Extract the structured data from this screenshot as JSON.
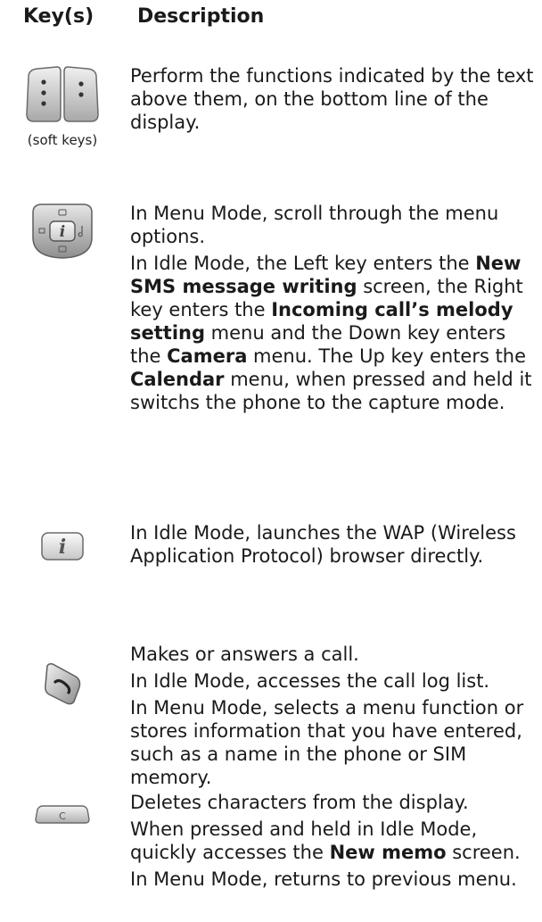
{
  "header": {
    "key_col": "Key(s)",
    "desc_col": "Description"
  },
  "rows": [
    {
      "caption": "(soft keys)",
      "icon": "soft-keys-icon",
      "paragraphs": [
        [
          {
            "t": "Perform the functions indicated by the text above them, on the bottom line of the display.",
            "b": false
          }
        ]
      ]
    },
    {
      "icon": "navigation-keys-icon",
      "paragraphs": [
        [
          {
            "t": "In Menu Mode, scroll through the menu options.",
            "b": false
          }
        ],
        [
          {
            "t": "In Idle Mode, the Left key enters the ",
            "b": false
          },
          {
            "t": "New SMS message writing",
            "b": true
          },
          {
            "t": " screen, the Right key enters the ",
            "b": false
          },
          {
            "t": "Incoming call’s melody setting",
            "b": true
          },
          {
            "t": " menu and the Down key enters the ",
            "b": false
          },
          {
            "t": "Camera",
            "b": true
          },
          {
            "t": " menu. The Up key enters the ",
            "b": false
          },
          {
            "t": "Calendar",
            "b": true
          },
          {
            "t": " menu, when pressed and held it switchs the phone to the capture mode.",
            "b": false
          }
        ]
      ]
    },
    {
      "icon": "wap-info-key-icon",
      "paragraphs": [
        [
          {
            "t": "In Idle Mode, launches the WAP (Wireless Application Protocol) browser directly.",
            "b": false
          }
        ]
      ]
    },
    {
      "icon": "send-call-key-icon",
      "paragraphs": [
        [
          {
            "t": "Makes or answers a call.",
            "b": false
          }
        ],
        [
          {
            "t": "In Idle Mode, accesses the call log list.",
            "b": false
          }
        ],
        [
          {
            "t": "In Menu Mode, selects a menu function or stores information that you have entered, such as a name in the phone or SIM memory.",
            "b": false
          }
        ]
      ]
    },
    {
      "icon": "clear-key-icon",
      "key_letter": "C",
      "paragraphs": [
        [
          {
            "t": "Deletes characters from the display.",
            "b": false
          }
        ],
        [
          {
            "t": "When pressed and held in Idle Mode, quickly accesses the ",
            "b": false
          },
          {
            "t": "New memo",
            "b": true
          },
          {
            "t": " screen.",
            "b": false
          }
        ],
        [
          {
            "t": "In Menu Mode, returns to previous menu.",
            "b": false
          }
        ]
      ]
    }
  ]
}
